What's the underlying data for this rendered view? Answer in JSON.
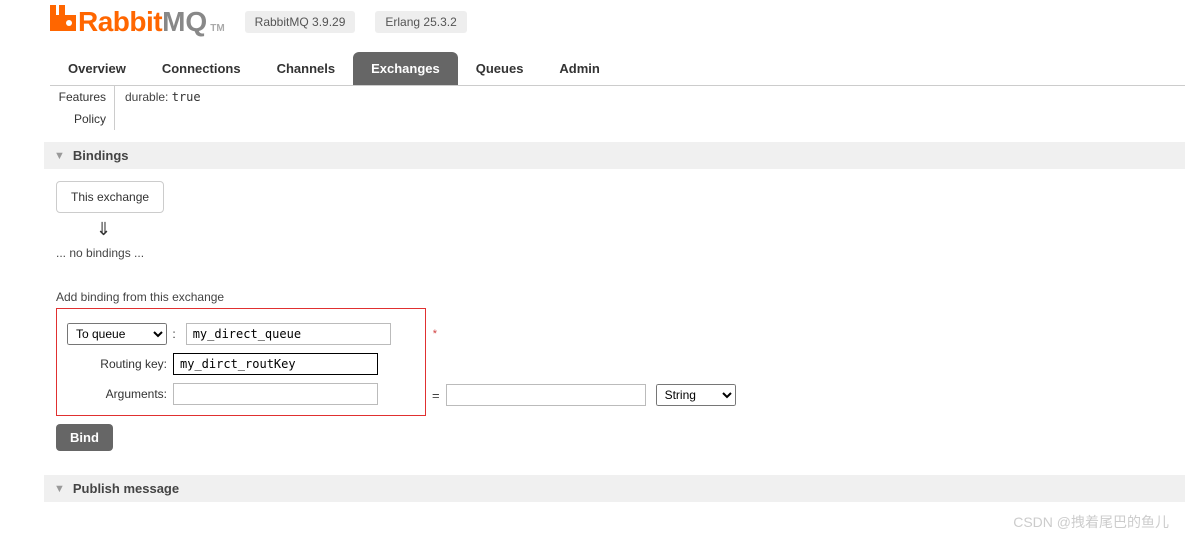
{
  "header": {
    "logo_rabbit": "Rabbit",
    "logo_mq": "MQ",
    "tm": "TM",
    "version": "RabbitMQ 3.9.29",
    "erlang": "Erlang 25.3.2"
  },
  "tabs": [
    "Overview",
    "Connections",
    "Channels",
    "Exchanges",
    "Queues",
    "Admin"
  ],
  "active_tab": "Exchanges",
  "features": {
    "features_label": "Features",
    "policy_label": "Policy",
    "durable_label": "durable:",
    "durable_value": "true"
  },
  "bindings": {
    "title": "Bindings",
    "this_exchange": "This exchange",
    "arrow": "⇓",
    "no_bindings": "... no bindings ...",
    "add_title": "Add binding from this exchange"
  },
  "form": {
    "to_queue_label": "To queue",
    "to_queue_value": "my_direct_queue",
    "routing_key_label": "Routing key:",
    "routing_key_value": "my_dirct_routKey",
    "arguments_label": "Arguments:",
    "arg_key": "",
    "arg_val": "",
    "arg_type": "String",
    "bind_button": "Bind"
  },
  "publish": {
    "title": "Publish message"
  },
  "watermark": "CSDN @拽着尾巴的鱼儿"
}
